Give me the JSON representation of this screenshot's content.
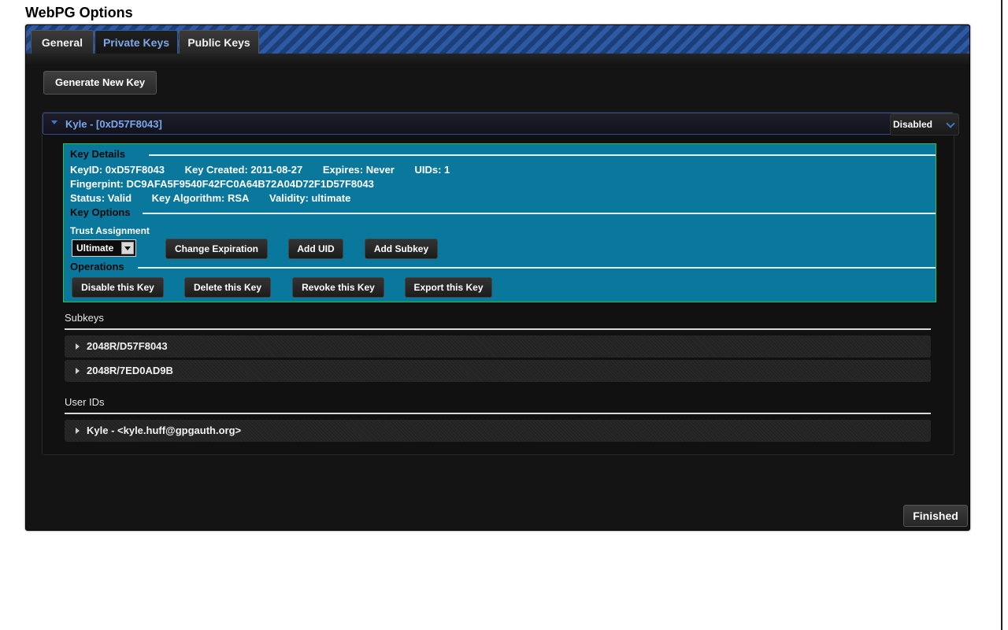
{
  "page_title": "WebPG Options",
  "tabs": [
    {
      "label": "General"
    },
    {
      "label": "Private Keys",
      "active": true
    },
    {
      "label": "Public Keys"
    }
  ],
  "generate_button": "Generate New Key",
  "key": {
    "title": "Kyle  -  [0xD57F8043]",
    "status": "Disabled",
    "details": {
      "heading": "Key Details",
      "key_id": "KeyID: 0xD57F8043",
      "created": "Key Created: 2011-08-27",
      "expires": "Expires: Never",
      "uids": "UIDs: 1",
      "fingerprint": "Fingerpint: DC9AFA5F9540F42FC0A64B72A04D72F1D57F8043",
      "status": "Status: Valid",
      "algorithm": "Key Algorithm: RSA",
      "validity": "Validity: ultimate"
    },
    "options": {
      "heading": "Key Options",
      "trust_label": "Trust Assignment",
      "trust_value": "Ultimate",
      "change_expiration": "Change Expiration",
      "add_uid": "Add UID",
      "add_subkey": "Add Subkey"
    },
    "operations": {
      "heading": "Operations",
      "disable": "Disable this Key",
      "delete": "Delete this Key",
      "revoke": "Revoke this Key",
      "export": "Export this Key"
    },
    "subkeys_label": "Subkeys",
    "subkeys": [
      "2048R/D57F8043",
      "2048R/7ED0AD9B"
    ],
    "user_ids_label": "User IDs",
    "user_ids": [
      "Kyle - <kyle.huff@gpgauth.org>"
    ]
  },
  "finished_button": "Finished",
  "colors": {
    "details_bg": "#0a789c",
    "details_border": "#2fbf3a",
    "tab_active_text": "#7da7e8",
    "key_title": "#79a8ee"
  }
}
